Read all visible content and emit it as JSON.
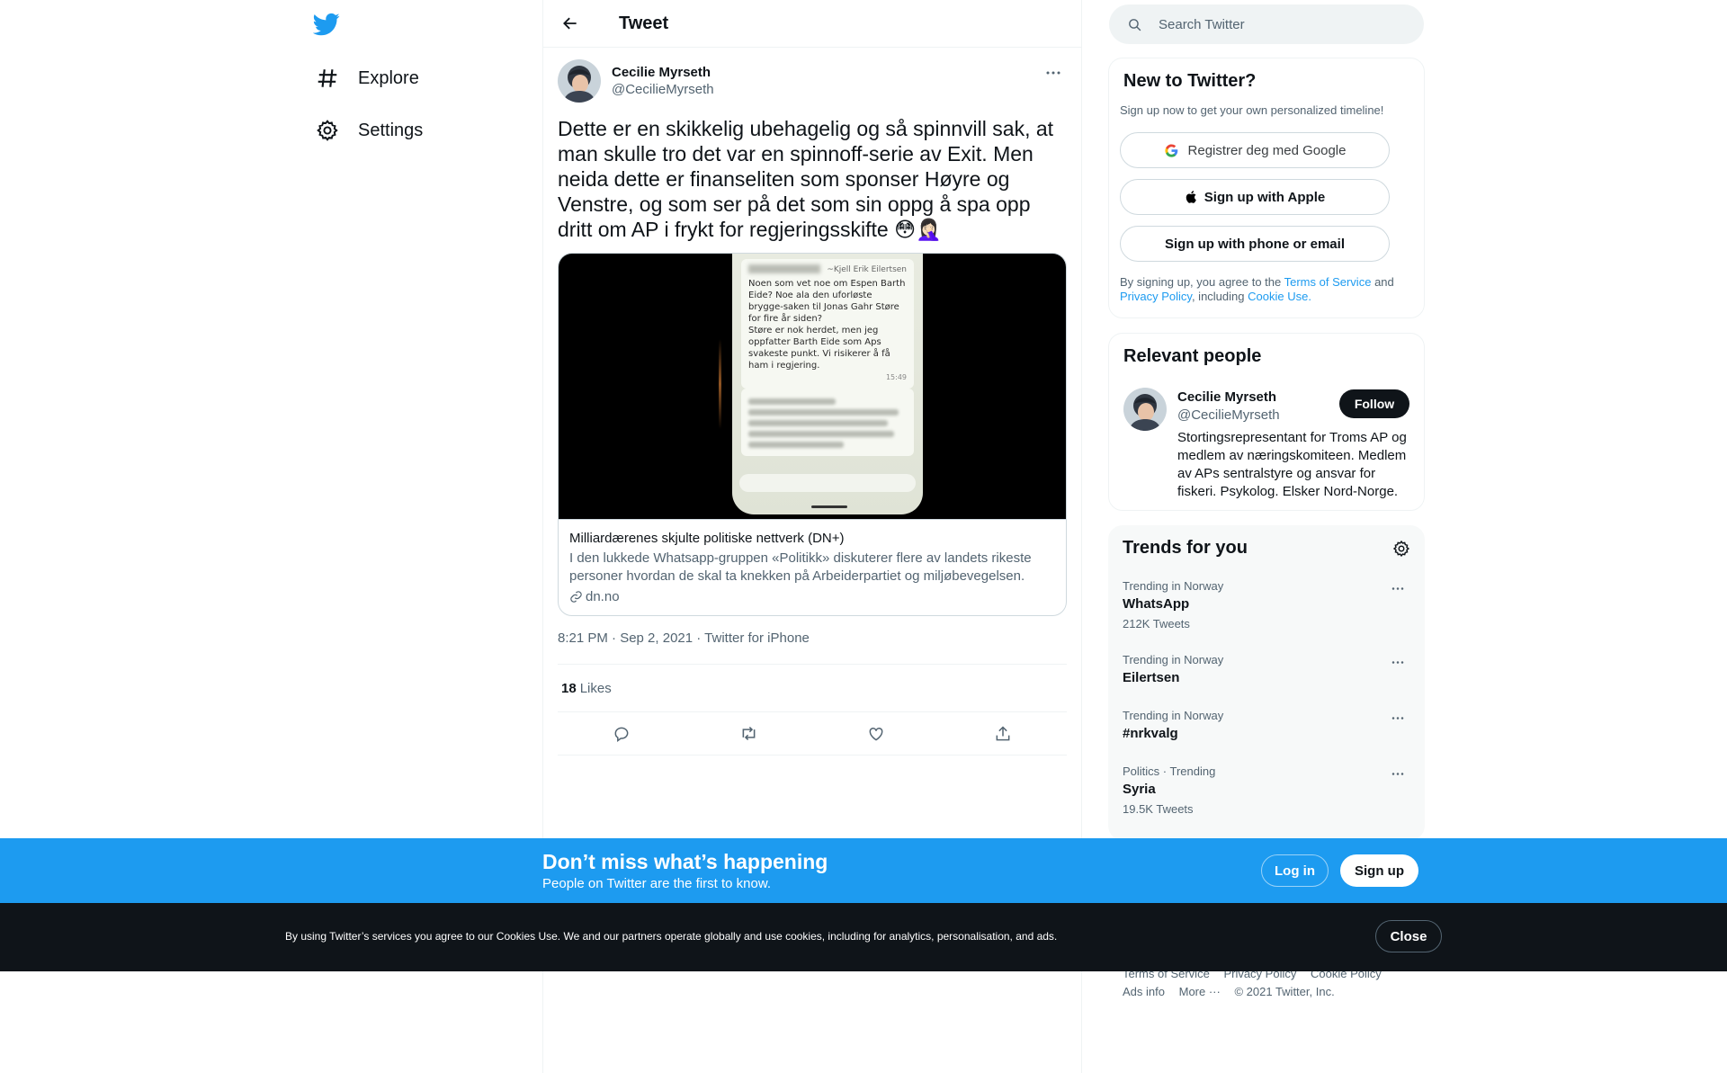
{
  "colors": {
    "brand": "#1d9bf0",
    "text": "#0f1419",
    "secondary": "#536471",
    "cookie_bar": "#0f1419"
  },
  "nav": {
    "logo_icon": "twitter-bird-icon",
    "items": [
      {
        "label": "Explore",
        "icon": "hashtag-icon"
      },
      {
        "label": "Settings",
        "icon": "gear-icon"
      }
    ]
  },
  "header": {
    "title": "Tweet"
  },
  "tweet": {
    "author_name": "Cecilie Myrseth",
    "author_handle": "@CecilieMyrseth",
    "text": "Dette er en skikkelig ubehagelig og så spinnvill sak, at man skulle tro det var en spinnoff-serie av Exit. Men neida dette er finanseliten som sponser Høyre og Venstre, og som ser på det som sin oppg å spa opp dritt om AP i frykt for regjeringsskifte 😳🤦🏻‍♀️",
    "card": {
      "screenshot": {
        "sender": "~Kjell Erik Eilertsen",
        "message": "Noen som vet noe om Espen Barth Eide? Noe ala den uforløste brygge-saken til Jonas Gahr Støre for fire år siden?\nStøre er nok herdet, men jeg oppfatter Barth Eide som Aps svakeste punkt. Vi risikerer å få ham i regjering.",
        "time": "15:49"
      },
      "title": "Milliardærenes skjulte politiske nettverk (DN+)",
      "description": "I den lukkede Whatsapp-gruppen «Politikk» diskuterer flere av landets rikeste personer hvordan de skal ta knekken på Arbeiderpartiet og miljøbevegelsen.",
      "domain": "dn.no"
    },
    "meta": "8:21 PM · Sep 2, 2021 · Twitter for iPhone",
    "likes_count": "18",
    "likes_label": "Likes"
  },
  "search": {
    "placeholder": "Search Twitter"
  },
  "signup_panel": {
    "title": "New to Twitter?",
    "subtitle": "Sign up now to get your own personalized timeline!",
    "google_label": "Registrer deg med Google",
    "apple_label": "Sign up with Apple",
    "phone_label": "Sign up with phone or email",
    "legal_prefix": "By signing up, you agree to the",
    "terms": "Terms of Service",
    "and": "and",
    "privacy": "Privacy Policy",
    "including": ", including",
    "cookie_use": "Cookie Use."
  },
  "relevant": {
    "title": "Relevant people",
    "name": "Cecilie Myrseth",
    "handle": "@CecilieMyrseth",
    "bio": "Stortingsrepresentant for Troms AP og medlem av næringskomiteen. Medlem av APs sentralstyre og ansvar for fiskeri. Psykolog. Elsker Nord-Norge.",
    "follow_label": "Follow"
  },
  "trends": {
    "title": "Trends for you",
    "items": [
      {
        "context": "Trending in Norway",
        "name": "WhatsApp",
        "count": "212K Tweets"
      },
      {
        "context": "Trending in Norway",
        "name": "Eilertsen",
        "count": ""
      },
      {
        "context": "Trending in Norway",
        "name": "#nrkvalg",
        "count": ""
      },
      {
        "context": "Politics · Trending",
        "name": "Syria",
        "count": "19.5K Tweets"
      }
    ]
  },
  "footer": {
    "terms": "Terms of Service",
    "privacy": "Privacy Policy",
    "cookie": "Cookie Policy",
    "ads": "Ads info",
    "more": "More ···",
    "copyright": "© 2021 Twitter, Inc."
  },
  "banner": {
    "headline": "Don’t miss what’s happening",
    "sub": "People on Twitter are the first to know.",
    "login_label": "Log in",
    "signup_label": "Sign up"
  },
  "cookie_bar": {
    "text": "By using Twitter’s services you agree to our Cookies Use. We and our partners operate globally and use cookies, including for analytics, personalisation, and ads.",
    "close_label": "Close"
  }
}
